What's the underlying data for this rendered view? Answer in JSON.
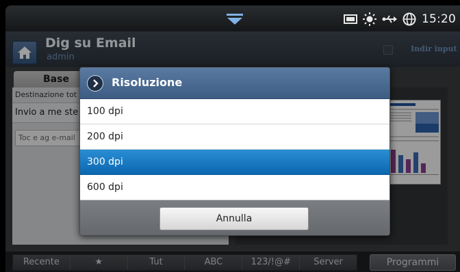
{
  "status": {
    "time": "15:20",
    "icons": [
      "drawer-handle-icon",
      "toner-icon",
      "brightness-icon",
      "usb-icon",
      "network-globe-icon"
    ]
  },
  "header": {
    "title": "Dig su Email",
    "user": "admin",
    "link": "Indir input"
  },
  "content": {
    "tab": "Base",
    "destination_label": "Destinazione tot",
    "invio_label": "Invio a me ste",
    "email_placeholder": "Toc e ag e-mail"
  },
  "dialog": {
    "title": "Risoluzione",
    "options": [
      "100 dpi",
      "200 dpi",
      "300 dpi",
      "600 dpi"
    ],
    "selected": "300 dpi",
    "cancel_label": "Annulla"
  },
  "bottom": {
    "tabs": [
      "Recente",
      "★",
      "Tut",
      "ABC",
      "123/!@#",
      "Server"
    ],
    "programs_label": "Programmi"
  },
  "colors": {
    "selection": "#1a7cc4",
    "dialog_title": "#4a6a92",
    "header_link": "#6c90b8"
  }
}
